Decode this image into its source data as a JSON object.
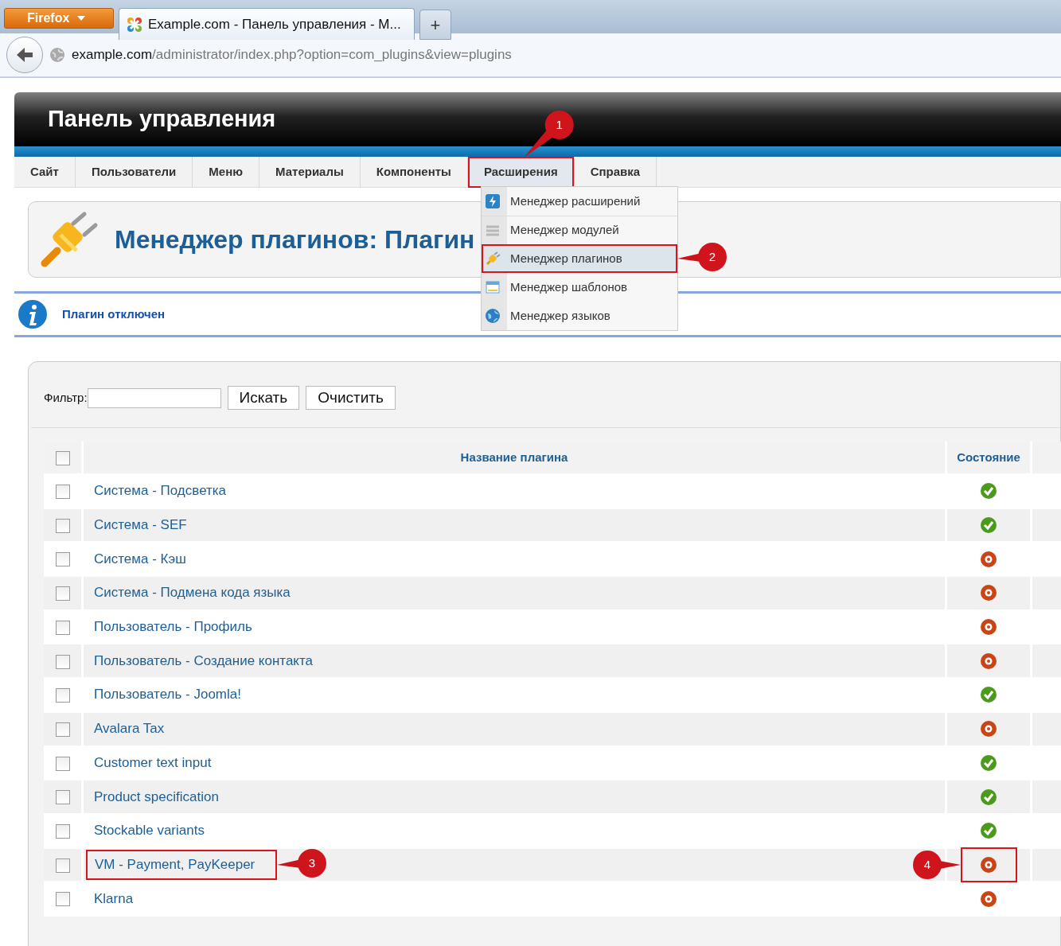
{
  "browser": {
    "menu_button": "Firefox",
    "tabs": [
      {
        "title": "Example.com - Панель управления - M...",
        "selected": true
      }
    ],
    "new_tab": "+",
    "url_host": "example.com",
    "url_path": "/administrator/index.php?option=com_plugins&view=plugins"
  },
  "header": {
    "title": "Панель управления"
  },
  "menu": [
    {
      "label": "Сайт",
      "selected": false,
      "highlighted": false
    },
    {
      "label": "Пользователи",
      "selected": false,
      "highlighted": false
    },
    {
      "label": "Меню",
      "selected": false,
      "highlighted": false
    },
    {
      "label": "Материалы",
      "selected": false,
      "highlighted": false
    },
    {
      "label": "Компоненты",
      "selected": false,
      "highlighted": false
    },
    {
      "label": "Расширения",
      "selected": true,
      "highlighted": true,
      "callout": "1"
    },
    {
      "label": "Справка",
      "selected": false,
      "highlighted": false
    }
  ],
  "dropdown": [
    {
      "label": "Менеджер расширений",
      "selected": false,
      "highlighted": false
    },
    {
      "label": "Менеджер модулей",
      "selected": false,
      "highlighted": false
    },
    {
      "label": "Менеджер плагинов",
      "selected": true,
      "highlighted": true,
      "callout": "2"
    },
    {
      "label": "Менеджер шаблонов",
      "selected": false,
      "highlighted": false
    },
    {
      "label": "Менеджер языков",
      "selected": false,
      "highlighted": false
    }
  ],
  "page_title": "Менеджер плагинов: Плагин",
  "message": "Плагин отключен",
  "filter": {
    "label": "Фильтр:",
    "search_button": "Искать",
    "clear_button": "Очистить"
  },
  "table": {
    "select_all_checked": false,
    "columns": [
      "Название плагина",
      "Состояние"
    ],
    "rows": [
      {
        "name": "Система - Подсветка",
        "checked": false,
        "enabled": true,
        "name_highlighted": false,
        "status_highlighted": false
      },
      {
        "name": "Система - SEF",
        "checked": false,
        "enabled": true,
        "name_highlighted": false,
        "status_highlighted": false
      },
      {
        "name": "Система - Кэш",
        "checked": false,
        "enabled": false,
        "name_highlighted": false,
        "status_highlighted": false
      },
      {
        "name": "Система - Подмена кода языка",
        "checked": false,
        "enabled": false,
        "name_highlighted": false,
        "status_highlighted": false
      },
      {
        "name": "Пользователь - Профиль",
        "checked": false,
        "enabled": false,
        "name_highlighted": false,
        "status_highlighted": false
      },
      {
        "name": "Пользователь - Создание контакта",
        "checked": false,
        "enabled": false,
        "name_highlighted": false,
        "status_highlighted": false
      },
      {
        "name": "Пользователь - Joomla!",
        "checked": false,
        "enabled": true,
        "name_highlighted": false,
        "status_highlighted": false
      },
      {
        "name": "Avalara Tax",
        "checked": false,
        "enabled": false,
        "name_highlighted": false,
        "status_highlighted": false
      },
      {
        "name": "Customer text input",
        "checked": false,
        "enabled": true,
        "name_highlighted": false,
        "status_highlighted": false
      },
      {
        "name": "Product specification",
        "checked": false,
        "enabled": true,
        "name_highlighted": false,
        "status_highlighted": false
      },
      {
        "name": "Stockable variants",
        "checked": false,
        "enabled": true,
        "name_highlighted": false,
        "status_highlighted": false
      },
      {
        "name": "VM - Payment, PayKeeper",
        "checked": false,
        "enabled": false,
        "name_highlighted": true,
        "name_callout": "3",
        "status_highlighted": true,
        "status_callout": "4"
      },
      {
        "name": "Klarna",
        "checked": false,
        "enabled": false,
        "name_highlighted": false,
        "status_highlighted": false
      }
    ]
  }
}
